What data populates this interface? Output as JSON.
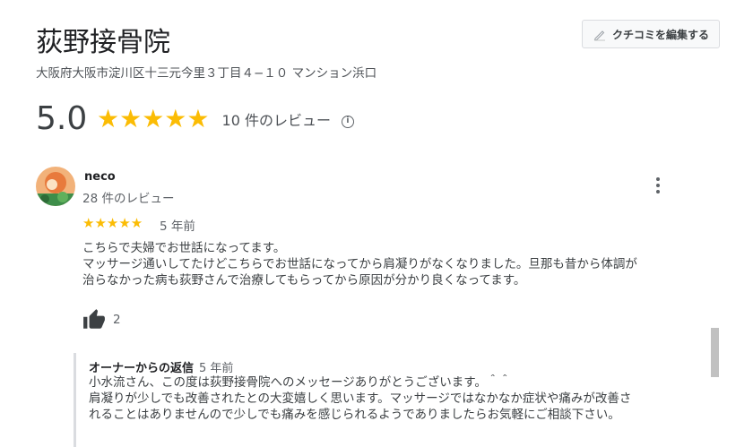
{
  "place": {
    "name": "荻野接骨院",
    "address": "大阪府大阪市淀川区十三元今里３丁目４−１０ マンション浜口",
    "rating": "5.0",
    "stars": "★★★★★",
    "review_count": "10 件のレビュー",
    "info_icon_label": "i"
  },
  "edit_button": {
    "label": "クチコミを編集する",
    "icon": "pencil-icon"
  },
  "review": {
    "author": "neco",
    "author_reviews": "28 件のレビュー",
    "stars": "★★★★★",
    "time": "5 年前",
    "text": [
      "こちらで夫婦でお世話になってます。",
      "マッサージ通いしてたけどこちらでお世話になってから肩凝りがなくなりました。旦那も昔から体調が",
      "治らなかった病も荻野さんで治療してもらってから原因が分かり良くなってます。"
    ],
    "likes": "2"
  },
  "owner_reply": {
    "label": "オーナーからの返信",
    "time": "5 年前",
    "text": [
      "小水流さん、この度は荻野接骨院へのメッセージありがとうございます。＾＾",
      "肩凝りが少しでも改善されたとの大変嬉しく思います。マッサージではなかなか症状や痛みが改善さ",
      "れることはありませんので少しでも痛みを感じられるようでありましたらお気軽にご相談下さい。"
    ]
  },
  "colors": {
    "star": "#fbbc04",
    "text": "#202124",
    "muted": "#5f6368"
  }
}
